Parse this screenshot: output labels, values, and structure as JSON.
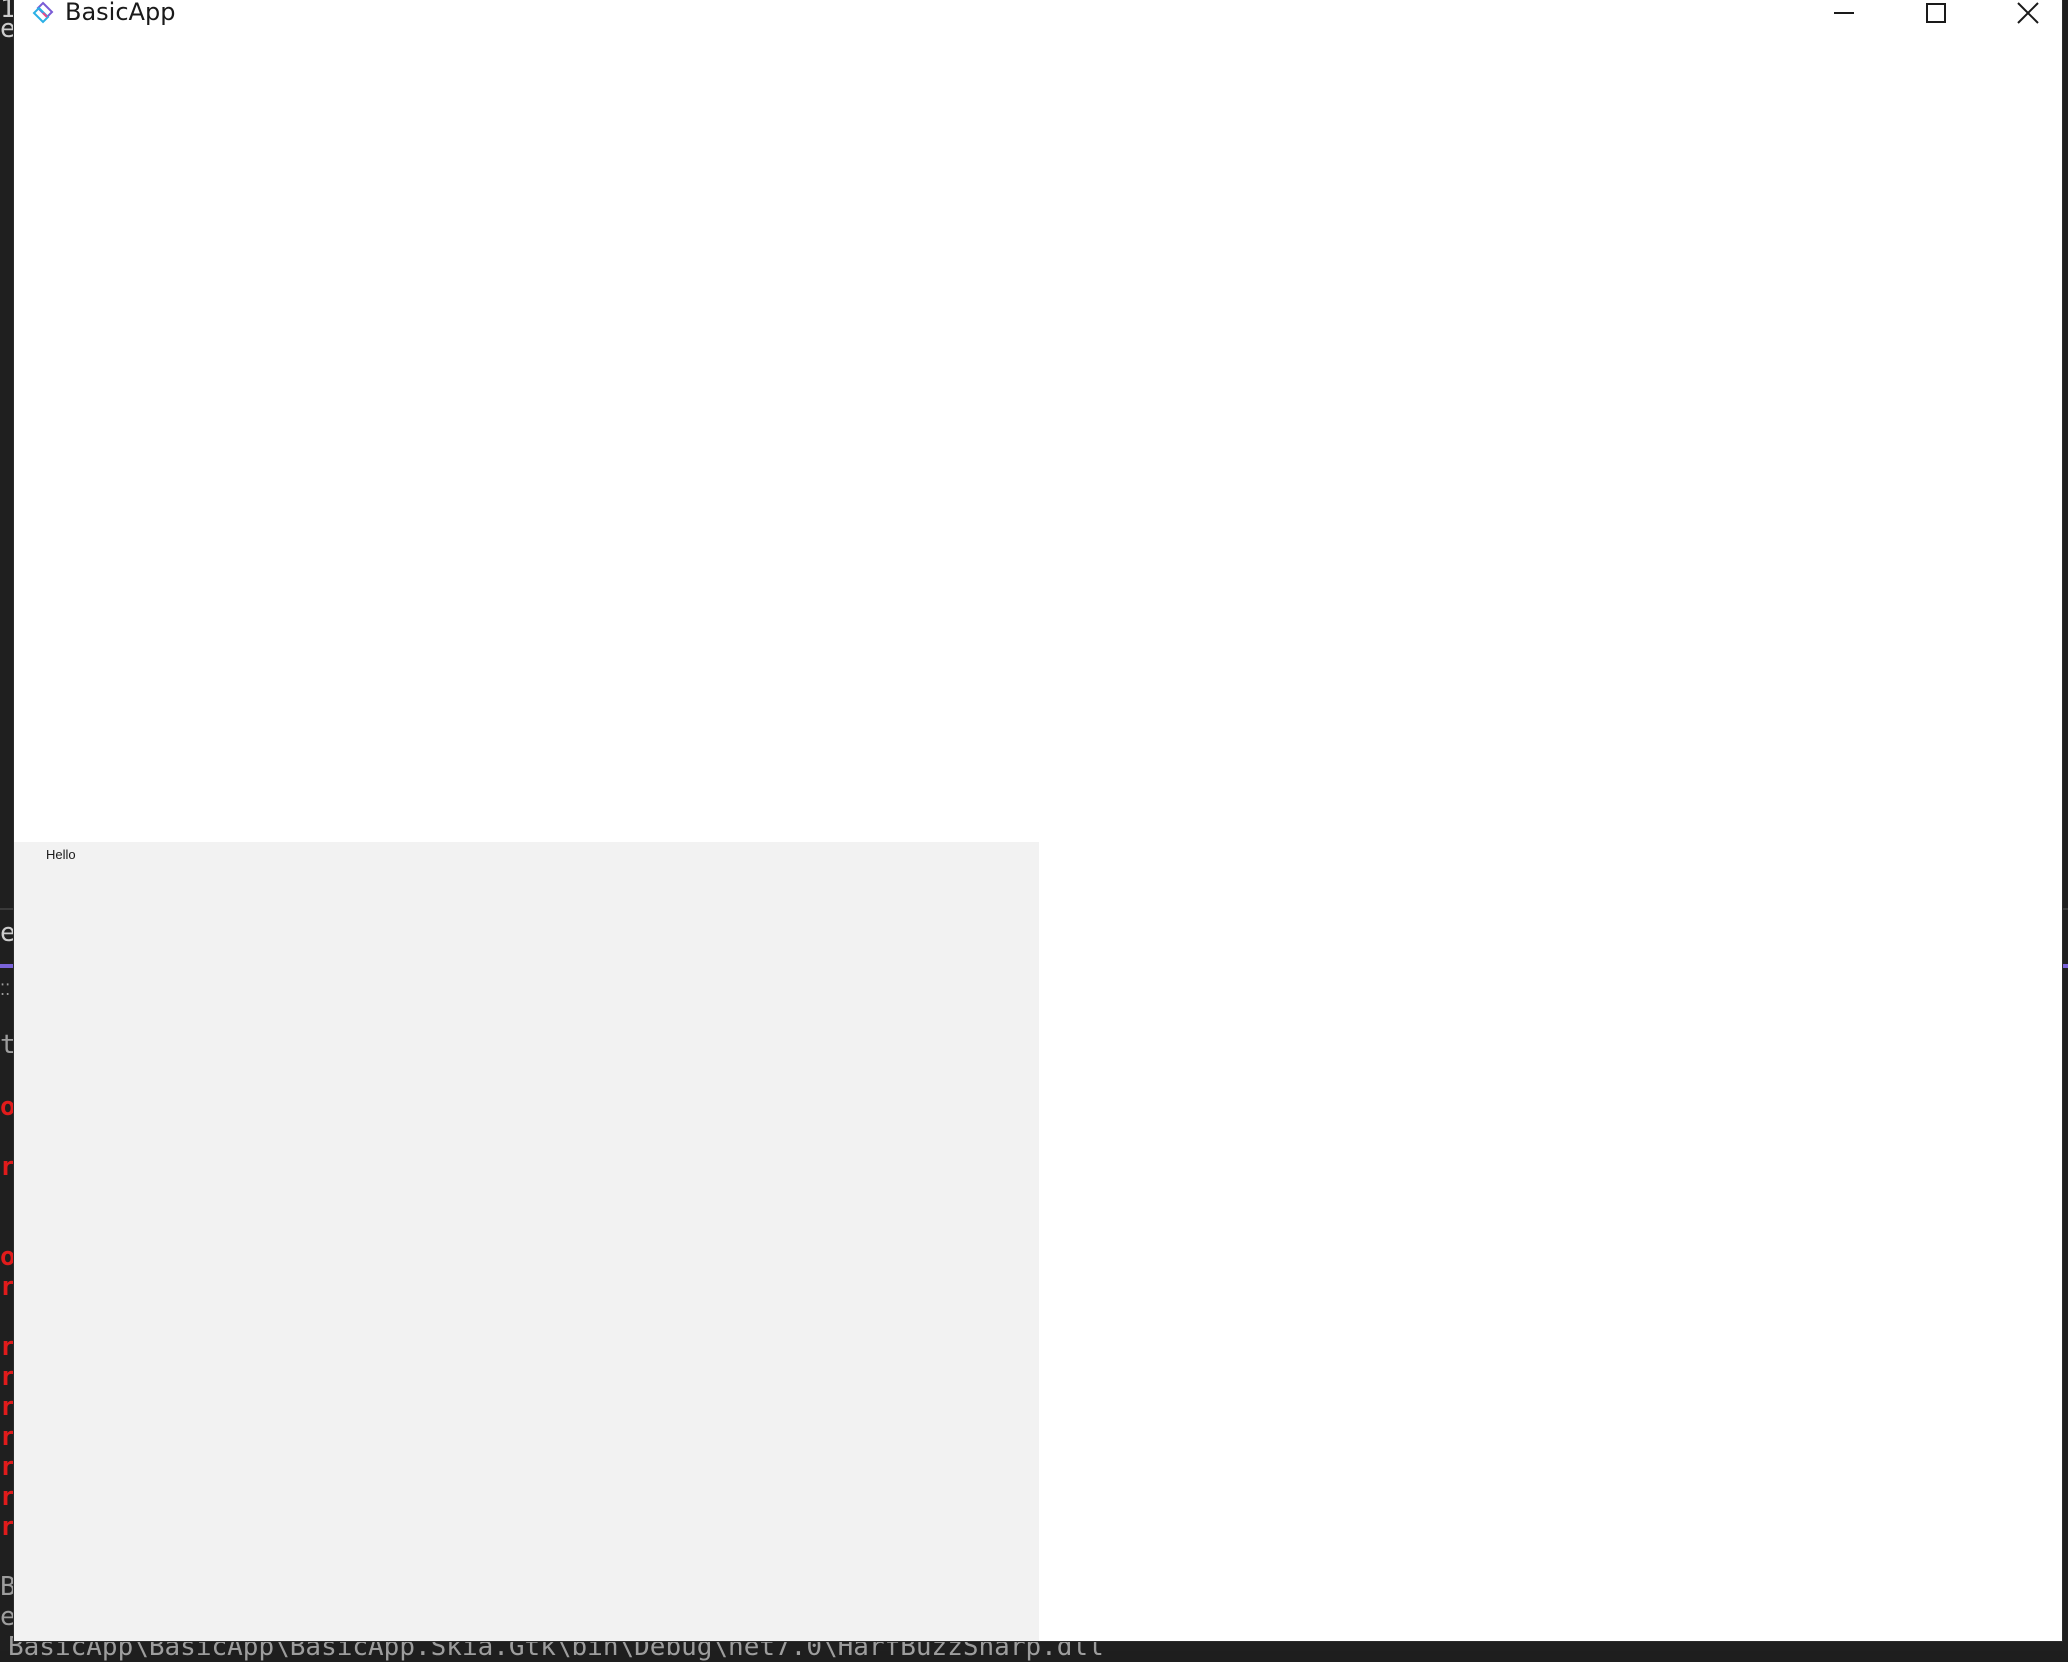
{
  "window": {
    "title": "BasicApp",
    "icon": "app-logo-icon",
    "controls": {
      "minimize_icon": "minimize-icon",
      "maximize_icon": "maximize-icon",
      "close_icon": "close-icon"
    }
  },
  "content": {
    "text_block": "Hello"
  },
  "background_terminal": {
    "lines": [
      {
        "text": "1",
        "style": "normal"
      },
      {
        "text": "e",
        "style": "normal"
      },
      {
        "text": "es",
        "style": "normal"
      },
      {
        "text": "⁚⁚",
        "style": "gray"
      },
      {
        "text": "t",
        "style": "gray"
      },
      {
        "text": "o",
        "style": "red"
      },
      {
        "text": "rs",
        "style": "red"
      },
      {
        "text": "o",
        "style": "red"
      },
      {
        "text": "rs",
        "style": "red"
      },
      {
        "text": "rs",
        "style": "red"
      },
      {
        "text": "rs",
        "style": "red"
      },
      {
        "text": "rs",
        "style": "red"
      },
      {
        "text": "rs",
        "style": "red"
      },
      {
        "text": "rs",
        "style": "red"
      },
      {
        "text": "rs",
        "style": "red"
      },
      {
        "text": "rs",
        "style": "red"
      },
      {
        "text": "B",
        "style": "gray"
      },
      {
        "text": "e",
        "style": "gray"
      },
      {
        "text": "BasicApp\\BasicApp\\BasicApp.Skia.Gtk\\bin\\Debug\\net7.0\\HarfBuzzSharp.dll",
        "style": "gray"
      }
    ]
  },
  "colors": {
    "window_background": "#ffffff",
    "panel_background": "#f2f2f2",
    "terminal_background": "#1f1f1f",
    "terminal_accent": "#7a63d9",
    "terminal_error": "#e01b1b"
  }
}
